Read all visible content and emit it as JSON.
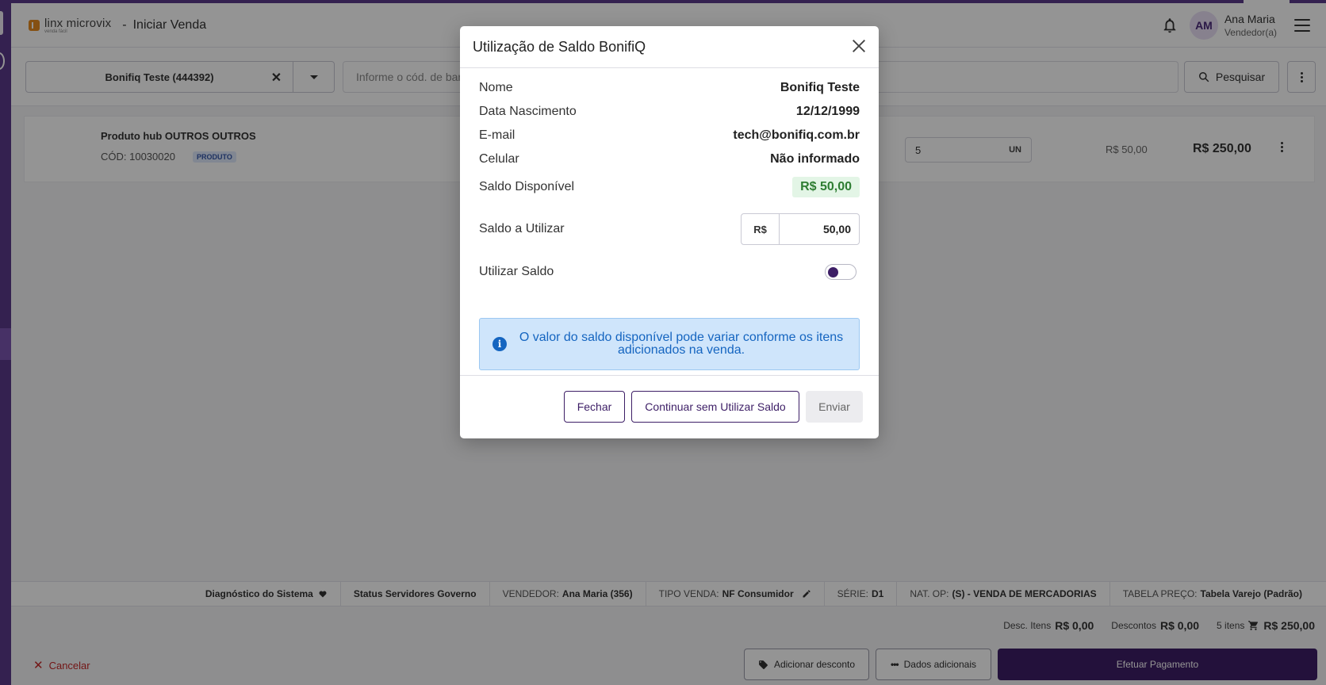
{
  "header": {
    "logo_text": "linx microvix",
    "logo_sub": "venda fácil",
    "separator": "-",
    "page_title": "Iniciar Venda",
    "user_initials": "AM",
    "user_name": "Ana Maria",
    "user_role": "Vendedor(a)"
  },
  "search": {
    "client_name": "Bonifiq Teste (444392)",
    "client_clear": "✕",
    "barcode_placeholder": "Informe o cód. de barras",
    "search_button": "Pesquisar"
  },
  "product": {
    "name": "Produto hub OUTROS OUTROS",
    "code": "CÓD: 10030020",
    "tag": "PRODUTO",
    "quantity": "5",
    "unit": "UN",
    "unit_price": "R$ 50,00",
    "total_price": "R$ 250,00"
  },
  "status_bar": {
    "diagnostic": "Diagnóstico do Sistema",
    "servers": "Status Servidores Governo",
    "seller_label": "VENDEDOR:",
    "seller_value": "Ana Maria (356)",
    "sale_type_label": "TIPO VENDA:",
    "sale_type_value": "NF Consumidor",
    "series_label": "SÉRIE:",
    "series_value": "D1",
    "natop_label": "NAT. OP:",
    "natop_value": "(S) - VENDA DE MERCADORIAS",
    "price_table_label": "TABELA PREÇO:",
    "price_table_value": "Tabela Varejo (Padrão)"
  },
  "totals": {
    "item_disc_label": "Desc. Itens",
    "item_disc_value": "R$ 0,00",
    "disc_label": "Descontos",
    "disc_value": "R$ 0,00",
    "items_label": "5 itens",
    "total_value": "R$ 250,00"
  },
  "footer": {
    "cancel": "Cancelar",
    "add_discount": "Adicionar desconto",
    "extra_data": "Dados adicionais",
    "pay": "Efetuar Pagamento"
  },
  "modal": {
    "title": "Utilização de Saldo BonifiQ",
    "name_label": "Nome",
    "name_value": "Bonifiq Teste",
    "birth_label": "Data Nascimento",
    "birth_value": "12/12/1999",
    "email_label": "E-mail",
    "email_value": "tech@bonifiq.com.br",
    "phone_label": "Celular",
    "phone_value": "Não informado",
    "balance_label": "Saldo Disponível",
    "balance_value": "R$ 50,00",
    "use_amount_label": "Saldo a Utilizar",
    "currency": "R$",
    "use_amount_value": "50,00",
    "use_toggle_label": "Utilizar Saldo",
    "use_toggle_on": false,
    "info_text": "O valor do saldo disponível pode variar conforme os itens adicionados na venda.",
    "btn_close": "Fechar",
    "btn_continue": "Continuar sem Utilizar Saldo",
    "btn_send": "Enviar"
  },
  "colors": {
    "brand": "#3d1e66",
    "rail": "#5b3a8a",
    "success_bg": "#e3f5e6",
    "info_bg": "#cfe5fb",
    "danger": "#c62828"
  }
}
